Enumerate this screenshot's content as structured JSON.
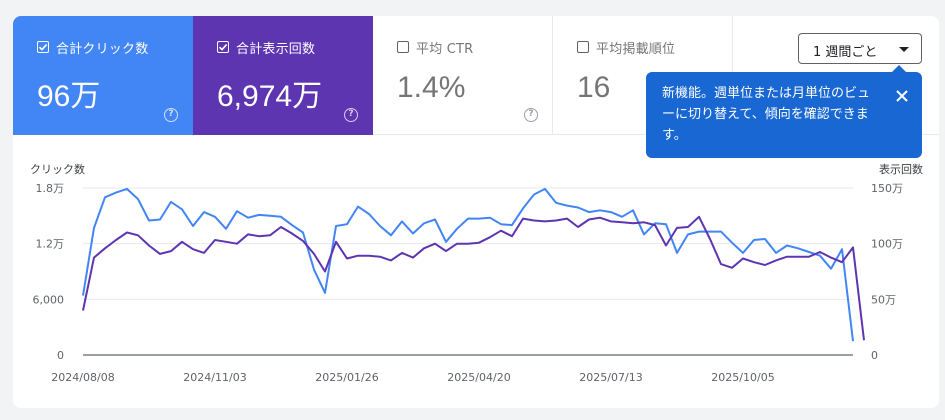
{
  "metrics": {
    "clicks": {
      "label": "合計クリック数",
      "value": "96万",
      "checked": true
    },
    "impressions": {
      "label": "合計表示回数",
      "value": "6,974万",
      "checked": true
    },
    "ctr": {
      "label": "平均 CTR",
      "value": "1.4%",
      "checked": false
    },
    "position": {
      "label": "平均掲載順位",
      "value": "16",
      "checked": false
    }
  },
  "period_dropdown": {
    "label": "1 週間ごと"
  },
  "tooltip": {
    "text": "新機能。週単位または月単位のビューに切り替えて、傾向を確認できます。"
  },
  "colors": {
    "clicks": "#4285f4",
    "impressions": "#5e35b1",
    "tooltip": "#1967d2"
  },
  "icons": {
    "help": "help-circle-icon",
    "check": "checkbox-check-icon",
    "close": "close-icon",
    "dropdown": "caret-down-icon"
  },
  "chart_data": {
    "type": "line",
    "left_axis_title": "クリック数",
    "right_axis_title": "表示回数",
    "left_ticks": [
      "0",
      "6,000",
      "1.2万",
      "1.8万"
    ],
    "right_ticks": [
      "0",
      "50万",
      "100万",
      "150万"
    ],
    "left_ylim": [
      0,
      18000
    ],
    "right_ylim": [
      0,
      1500000
    ],
    "x_tick_labels": [
      "2024/08/08",
      "2024/11/03",
      "2025/01/26",
      "2025/04/20",
      "2025/07/13",
      "2025/10/05"
    ],
    "x_tick_index": [
      0,
      12,
      24,
      36,
      48,
      60
    ],
    "series": [
      {
        "name": "合計クリック数",
        "axis": "left",
        "values": [
          6400,
          13700,
          17000,
          17500,
          17900,
          16800,
          14500,
          14600,
          16500,
          15700,
          13900,
          15400,
          14900,
          13600,
          15500,
          14800,
          15100,
          15000,
          14900,
          14000,
          13200,
          9200,
          6700,
          13900,
          14100,
          16000,
          15200,
          13900,
          12900,
          14400,
          13100,
          14200,
          14600,
          12200,
          13600,
          14700,
          14700,
          14800,
          14100,
          14000,
          15800,
          17300,
          17900,
          16400,
          16100,
          15900,
          15400,
          15600,
          15400,
          14900,
          15600,
          13000,
          14200,
          14100,
          11000,
          13000,
          13300,
          13300,
          13300,
          12100,
          11000,
          12400,
          12500,
          11000,
          11800,
          11500,
          11100,
          10700,
          9300,
          11400,
          1500
        ]
      },
      {
        "name": "合計表示回数",
        "axis": "left",
        "values": [
          4800,
          10500,
          11500,
          12400,
          13200,
          12900,
          11800,
          10900,
          11200,
          12200,
          11400,
          11000,
          12400,
          12200,
          12000,
          13000,
          12800,
          12900,
          13800,
          13100,
          12300,
          10900,
          9000,
          12200,
          10400,
          10700,
          10700,
          10600,
          10200,
          11000,
          10500,
          11500,
          12000,
          11200,
          12000,
          12000,
          12100,
          12700,
          13400,
          12800,
          14700,
          14500,
          14400,
          14500,
          14700,
          13800,
          14600,
          14800,
          14400,
          14300,
          14200,
          14300,
          14000,
          11800,
          13700,
          13800,
          14900,
          12500,
          9800,
          9400,
          10400,
          10000,
          9700,
          10200,
          10600,
          10600,
          10600,
          11100,
          10500,
          10000,
          11600,
          1600
        ]
      }
    ]
  }
}
